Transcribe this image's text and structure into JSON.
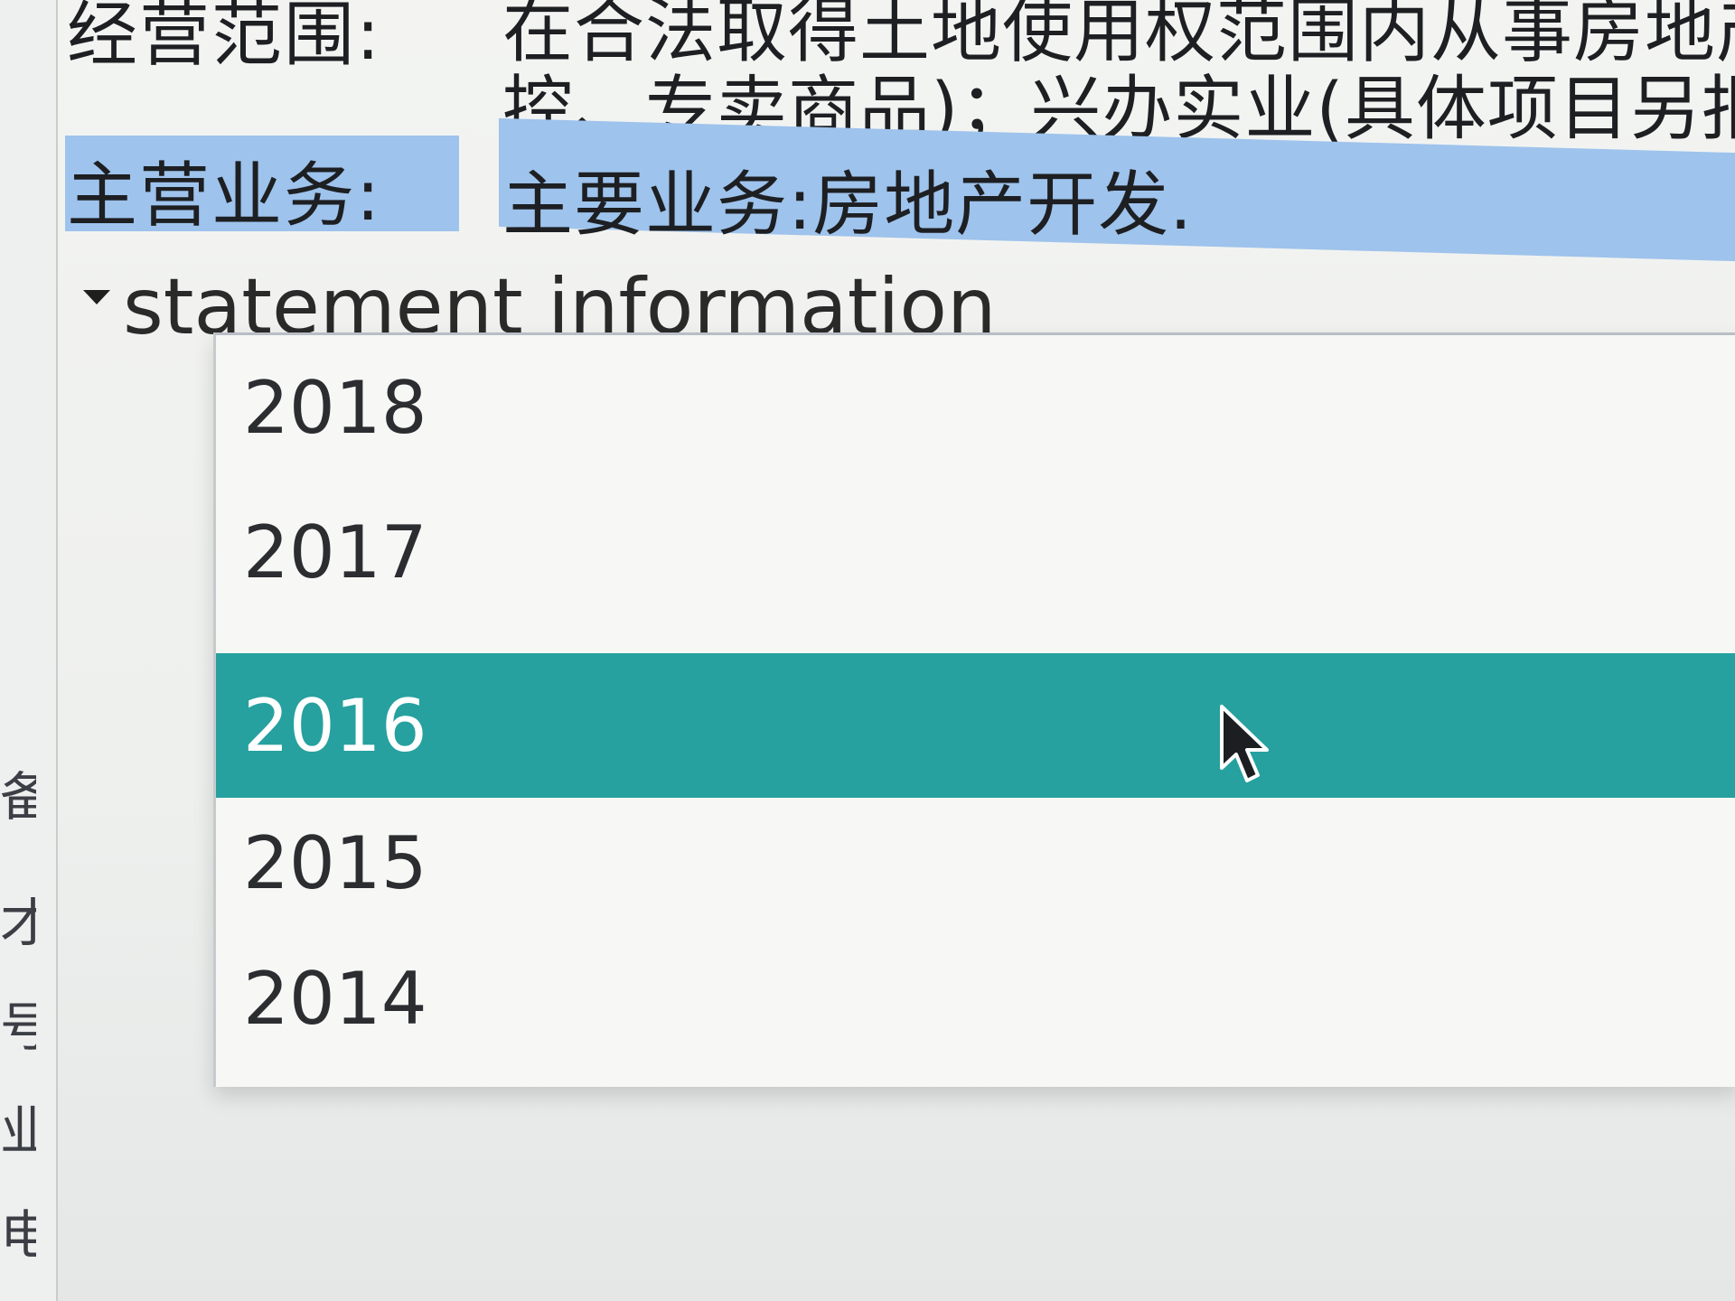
{
  "info": {
    "business_scope": {
      "label": "经营范围:",
      "value_line1": "在合法取得土地使用权范围内从事房地产",
      "value_line2": "控、专卖商品)；兴办实业(具体项目另报"
    },
    "main_business": {
      "label": "主营业务:",
      "value": "主要业务:房地产开发."
    }
  },
  "statement": {
    "expander_label": "statement information",
    "options": [
      "2018",
      "2017",
      "2016",
      "2015",
      "2014"
    ],
    "selected": "2016",
    "selected_color": "#26a19f"
  },
  "left_edge_chars": [
    "备",
    "才",
    "号",
    "业",
    "电"
  ],
  "colors": {
    "highlight": "#9ec3ec",
    "selection": "#26a19f"
  }
}
